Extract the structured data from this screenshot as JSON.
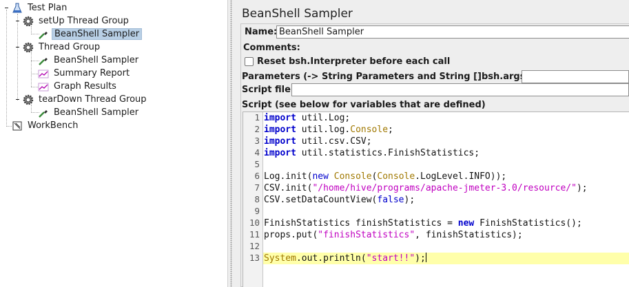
{
  "tree": {
    "test_plan": "Test Plan",
    "setup_group": "setUp Thread Group",
    "setup_sampler": "BeanShell Sampler",
    "thread_group": "Thread Group",
    "tg_sampler": "BeanShell Sampler",
    "summary_report": "Summary Report",
    "graph_results": "Graph Results",
    "teardown_group": "tearDown Thread Group",
    "teardown_sampler": "BeanShell Sampler",
    "workbench": "WorkBench"
  },
  "panel": {
    "title": "BeanShell Sampler",
    "name_label": "Name:",
    "name_value": "BeanShell Sampler",
    "comments_label": "Comments:",
    "reset_label": "Reset bsh.Interpreter before each call",
    "reset_checked": false,
    "params_label": "Parameters (-> String Parameters and String []bsh.args)",
    "params_value": "",
    "script_file_label": "Script file",
    "script_file_value": "",
    "script_label": "Script (see below for variables that are defined)"
  },
  "editor": {
    "current_line": 13,
    "lines": [
      {
        "n": "1",
        "tokens": [
          [
            "kw",
            "import"
          ],
          [
            "",
            "util.Log;"
          ]
        ]
      },
      {
        "n": "2",
        "tokens": [
          [
            "kw",
            "import"
          ],
          [
            "",
            "util.log."
          ],
          [
            "ty",
            "Console"
          ],
          [
            "",
            ";"
          ]
        ]
      },
      {
        "n": "3",
        "tokens": [
          [
            "kw",
            "import"
          ],
          [
            "",
            "util.csv.CSV;"
          ]
        ]
      },
      {
        "n": "4",
        "tokens": [
          [
            "kw",
            "import"
          ],
          [
            "",
            "util.statistics.FinishStatistics;"
          ]
        ]
      },
      {
        "n": "5",
        "tokens": []
      },
      {
        "n": "6",
        "tokens": [
          [
            "",
            "Log.init("
          ],
          [
            "kw2",
            "new"
          ],
          [
            "",
            ""
          ],
          [
            "ty",
            "Console"
          ],
          [
            "",
            "("
          ],
          [
            "ty",
            "Console"
          ],
          [
            "",
            ".LogLevel.INFO));"
          ]
        ]
      },
      {
        "n": "7",
        "tokens": [
          [
            "",
            "CSV.init("
          ],
          [
            "str",
            "\"/home/hive/programs/apache-jmeter-3.0/resource/\""
          ],
          [
            "",
            ");"
          ]
        ]
      },
      {
        "n": "8",
        "tokens": [
          [
            "",
            "CSV.setDataCountView("
          ],
          [
            "kw2",
            "false"
          ],
          [
            "",
            ");"
          ]
        ]
      },
      {
        "n": "9",
        "tokens": []
      },
      {
        "n": "10",
        "tokens": [
          [
            "",
            "FinishStatistics finishStatistics = "
          ],
          [
            "kw",
            "new"
          ],
          [
            "",
            "FinishStatistics();"
          ]
        ]
      },
      {
        "n": "11",
        "tokens": [
          [
            "",
            "props.put("
          ],
          [
            "str",
            "\"finishStatistics\""
          ],
          [
            "",
            ", finishStatistics);"
          ]
        ]
      },
      {
        "n": "12",
        "tokens": []
      },
      {
        "n": "13",
        "tokens": [
          [
            "ty",
            "System"
          ],
          [
            "",
            ".out.println("
          ],
          [
            "str",
            "\"start!!\""
          ],
          [
            "",
            ");"
          ]
        ]
      }
    ]
  }
}
